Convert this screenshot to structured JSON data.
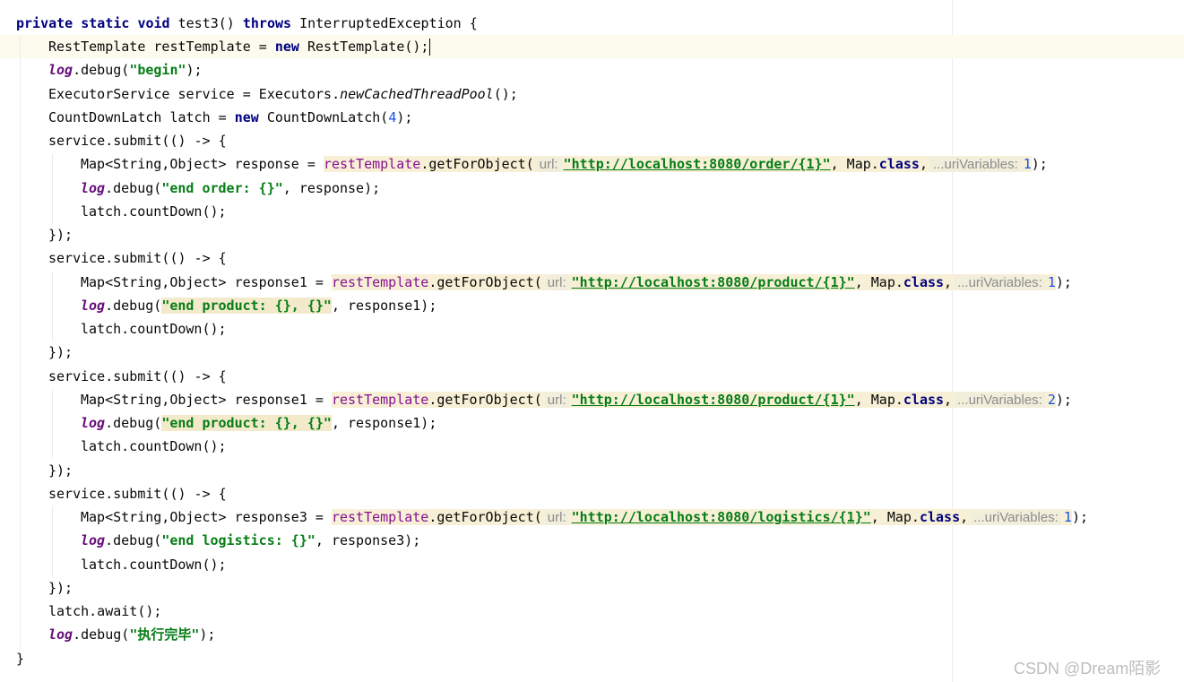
{
  "code": {
    "signature": {
      "kw_private": "private",
      "kw_static": "static",
      "kw_void": "void",
      "method_decl": " test3() ",
      "kw_throws": "throws",
      "exception": " InterruptedException {"
    },
    "rest_template_line": {
      "decl": "RestTemplate restTemplate = ",
      "kw_new": "new",
      "ctor": " RestTemplate();"
    },
    "log_begin": {
      "log": "log",
      "call": ".debug(",
      "msg": "\"begin\"",
      "end": ");"
    },
    "executor_line": {
      "decl": "ExecutorService service = Executors.",
      "method": "newCachedThreadPool",
      "end": "();"
    },
    "latch_line": {
      "decl": "CountDownLatch latch = ",
      "kw_new": "new",
      "ctor": " CountDownLatch(",
      "arg": "4",
      "end": ");"
    },
    "submit_open": "service.submit(() -> {",
    "submit_close": "});",
    "blocks": [
      {
        "map_decl": "Map<String,Object> response = ",
        "call_obj": "restTemplate",
        "call_method": ".getForObject(",
        "url_hint": "url:",
        "url": "\"http://localhost:8080/order/{1}\"",
        "map_class_pre": ", Map.",
        "kw_class": "class",
        "comma": ",",
        "vars_hint": "...uriVariables:",
        "var_value": "1",
        "call_end": ");",
        "log": "log",
        "log_call": ".debug(",
        "log_msg": "\"end order: {}\"",
        "log_rest": ", response);",
        "countdown": "latch.countDown();"
      },
      {
        "map_decl": "Map<String,Object> response1 = ",
        "call_obj": "restTemplate",
        "call_method": ".getForObject(",
        "url_hint": "url:",
        "url": "\"http://localhost:8080/product/{1}\"",
        "map_class_pre": ", Map.",
        "kw_class": "class",
        "comma": ",",
        "vars_hint": "...uriVariables:",
        "var_value": "1",
        "call_end": ");",
        "log": "log",
        "log_call": ".debug(",
        "log_msg": "\"end product: {}, {}\"",
        "log_rest": ", response1);",
        "countdown": "latch.countDown();"
      },
      {
        "map_decl": "Map<String,Object> response1 = ",
        "call_obj": "restTemplate",
        "call_method": ".getForObject(",
        "url_hint": "url:",
        "url": "\"http://localhost:8080/product/{1}\"",
        "map_class_pre": ", Map.",
        "kw_class": "class",
        "comma": ",",
        "vars_hint": "...uriVariables:",
        "var_value": "2",
        "call_end": ");",
        "log": "log",
        "log_call": ".debug(",
        "log_msg": "\"end product: {}, {}\"",
        "log_rest": ", response1);",
        "countdown": "latch.countDown();"
      },
      {
        "map_decl": "Map<String,Object> response3 = ",
        "call_obj": "restTemplate",
        "call_method": ".getForObject(",
        "url_hint": "url:",
        "url": "\"http://localhost:8080/logistics/{1}\"",
        "map_class_pre": ", Map.",
        "kw_class": "class",
        "comma": ",",
        "vars_hint": "...uriVariables:",
        "var_value": "1",
        "call_end": ");",
        "log": "log",
        "log_call": ".debug(",
        "log_msg": "\"end logistics: {}\"",
        "log_rest": ", response3);",
        "countdown": "latch.countDown();"
      }
    ],
    "await_line": "latch.await();",
    "log_done": {
      "log": "log",
      "call": ".debug(",
      "msg": "\"执行完毕\"",
      "end": ");"
    },
    "method_close": "}"
  },
  "watermark": "CSDN @Dream陌影",
  "colors": {
    "keyword": "#000080",
    "string": "#067d17",
    "number": "#1750eb",
    "log_field": "#660e7a",
    "hint": "#8c8c8c",
    "highlight": "#f7f0d6",
    "caret_row": "#fdfbee"
  }
}
